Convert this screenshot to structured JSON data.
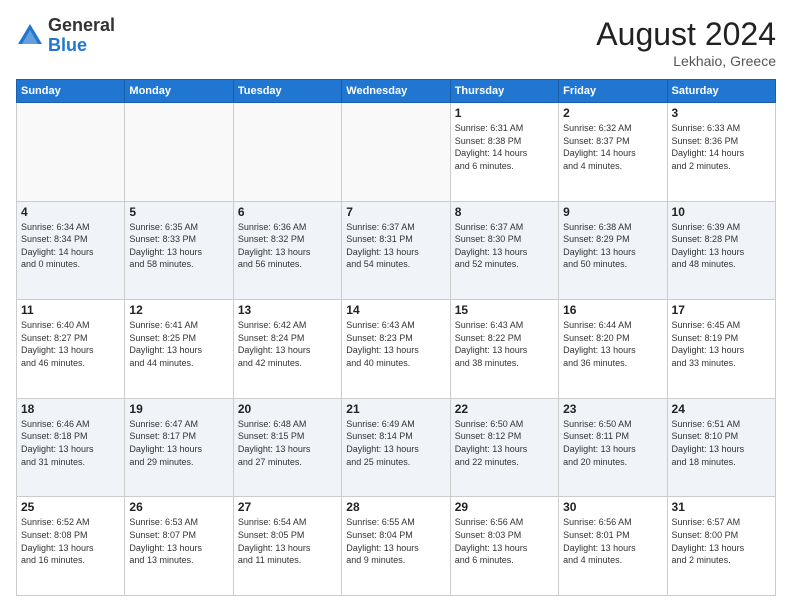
{
  "logo": {
    "general": "General",
    "blue": "Blue"
  },
  "header": {
    "month_year": "August 2024",
    "location": "Lekhaio, Greece"
  },
  "weekdays": [
    "Sunday",
    "Monday",
    "Tuesday",
    "Wednesday",
    "Thursday",
    "Friday",
    "Saturday"
  ],
  "rows": [
    [
      {
        "day": "",
        "info": ""
      },
      {
        "day": "",
        "info": ""
      },
      {
        "day": "",
        "info": ""
      },
      {
        "day": "",
        "info": ""
      },
      {
        "day": "1",
        "info": "Sunrise: 6:31 AM\nSunset: 8:38 PM\nDaylight: 14 hours\nand 6 minutes."
      },
      {
        "day": "2",
        "info": "Sunrise: 6:32 AM\nSunset: 8:37 PM\nDaylight: 14 hours\nand 4 minutes."
      },
      {
        "day": "3",
        "info": "Sunrise: 6:33 AM\nSunset: 8:36 PM\nDaylight: 14 hours\nand 2 minutes."
      }
    ],
    [
      {
        "day": "4",
        "info": "Sunrise: 6:34 AM\nSunset: 8:34 PM\nDaylight: 14 hours\nand 0 minutes."
      },
      {
        "day": "5",
        "info": "Sunrise: 6:35 AM\nSunset: 8:33 PM\nDaylight: 13 hours\nand 58 minutes."
      },
      {
        "day": "6",
        "info": "Sunrise: 6:36 AM\nSunset: 8:32 PM\nDaylight: 13 hours\nand 56 minutes."
      },
      {
        "day": "7",
        "info": "Sunrise: 6:37 AM\nSunset: 8:31 PM\nDaylight: 13 hours\nand 54 minutes."
      },
      {
        "day": "8",
        "info": "Sunrise: 6:37 AM\nSunset: 8:30 PM\nDaylight: 13 hours\nand 52 minutes."
      },
      {
        "day": "9",
        "info": "Sunrise: 6:38 AM\nSunset: 8:29 PM\nDaylight: 13 hours\nand 50 minutes."
      },
      {
        "day": "10",
        "info": "Sunrise: 6:39 AM\nSunset: 8:28 PM\nDaylight: 13 hours\nand 48 minutes."
      }
    ],
    [
      {
        "day": "11",
        "info": "Sunrise: 6:40 AM\nSunset: 8:27 PM\nDaylight: 13 hours\nand 46 minutes."
      },
      {
        "day": "12",
        "info": "Sunrise: 6:41 AM\nSunset: 8:25 PM\nDaylight: 13 hours\nand 44 minutes."
      },
      {
        "day": "13",
        "info": "Sunrise: 6:42 AM\nSunset: 8:24 PM\nDaylight: 13 hours\nand 42 minutes."
      },
      {
        "day": "14",
        "info": "Sunrise: 6:43 AM\nSunset: 8:23 PM\nDaylight: 13 hours\nand 40 minutes."
      },
      {
        "day": "15",
        "info": "Sunrise: 6:43 AM\nSunset: 8:22 PM\nDaylight: 13 hours\nand 38 minutes."
      },
      {
        "day": "16",
        "info": "Sunrise: 6:44 AM\nSunset: 8:20 PM\nDaylight: 13 hours\nand 36 minutes."
      },
      {
        "day": "17",
        "info": "Sunrise: 6:45 AM\nSunset: 8:19 PM\nDaylight: 13 hours\nand 33 minutes."
      }
    ],
    [
      {
        "day": "18",
        "info": "Sunrise: 6:46 AM\nSunset: 8:18 PM\nDaylight: 13 hours\nand 31 minutes."
      },
      {
        "day": "19",
        "info": "Sunrise: 6:47 AM\nSunset: 8:17 PM\nDaylight: 13 hours\nand 29 minutes."
      },
      {
        "day": "20",
        "info": "Sunrise: 6:48 AM\nSunset: 8:15 PM\nDaylight: 13 hours\nand 27 minutes."
      },
      {
        "day": "21",
        "info": "Sunrise: 6:49 AM\nSunset: 8:14 PM\nDaylight: 13 hours\nand 25 minutes."
      },
      {
        "day": "22",
        "info": "Sunrise: 6:50 AM\nSunset: 8:12 PM\nDaylight: 13 hours\nand 22 minutes."
      },
      {
        "day": "23",
        "info": "Sunrise: 6:50 AM\nSunset: 8:11 PM\nDaylight: 13 hours\nand 20 minutes."
      },
      {
        "day": "24",
        "info": "Sunrise: 6:51 AM\nSunset: 8:10 PM\nDaylight: 13 hours\nand 18 minutes."
      }
    ],
    [
      {
        "day": "25",
        "info": "Sunrise: 6:52 AM\nSunset: 8:08 PM\nDaylight: 13 hours\nand 16 minutes."
      },
      {
        "day": "26",
        "info": "Sunrise: 6:53 AM\nSunset: 8:07 PM\nDaylight: 13 hours\nand 13 minutes."
      },
      {
        "day": "27",
        "info": "Sunrise: 6:54 AM\nSunset: 8:05 PM\nDaylight: 13 hours\nand 11 minutes."
      },
      {
        "day": "28",
        "info": "Sunrise: 6:55 AM\nSunset: 8:04 PM\nDaylight: 13 hours\nand 9 minutes."
      },
      {
        "day": "29",
        "info": "Sunrise: 6:56 AM\nSunset: 8:03 PM\nDaylight: 13 hours\nand 6 minutes."
      },
      {
        "day": "30",
        "info": "Sunrise: 6:56 AM\nSunset: 8:01 PM\nDaylight: 13 hours\nand 4 minutes."
      },
      {
        "day": "31",
        "info": "Sunrise: 6:57 AM\nSunset: 8:00 PM\nDaylight: 13 hours\nand 2 minutes."
      }
    ]
  ],
  "colors": {
    "header_bg": "#2176d2",
    "row_shade": "#f0f4f8"
  }
}
